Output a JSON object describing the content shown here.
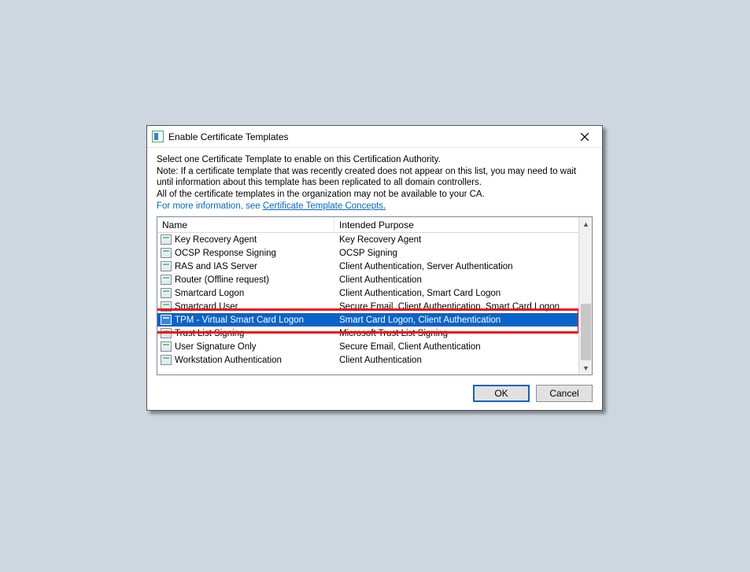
{
  "dialog": {
    "title": "Enable Certificate Templates",
    "instructions": {
      "line1": "Select one Certificate Template to enable on this Certification Authority.",
      "line2": "Note: If a certificate template that was recently created does not appear on this list, you may need to wait until information about this template has been replicated to all domain controllers.",
      "line3": "All of the certificate templates in the organization may not be available to your CA.",
      "moreinfo_prefix": "For more information, see ",
      "moreinfo_link": "Certificate Template Concepts."
    },
    "columns": {
      "name": "Name",
      "purpose": "Intended Purpose"
    },
    "rows": [
      {
        "name": "Key Recovery Agent",
        "purpose": "Key Recovery Agent",
        "selected": false
      },
      {
        "name": "OCSP Response Signing",
        "purpose": "OCSP Signing",
        "selected": false
      },
      {
        "name": "RAS and IAS Server",
        "purpose": "Client Authentication, Server Authentication",
        "selected": false
      },
      {
        "name": "Router (Offline request)",
        "purpose": "Client Authentication",
        "selected": false
      },
      {
        "name": "Smartcard Logon",
        "purpose": "Client Authentication, Smart Card Logon",
        "selected": false
      },
      {
        "name": "Smartcard User",
        "purpose": "Secure Email, Client Authentication, Smart Card Logon",
        "selected": false
      },
      {
        "name": "TPM - Virtual Smart Card Logon",
        "purpose": "Smart Card Logon, Client Authentication",
        "selected": true
      },
      {
        "name": "Trust List Signing",
        "purpose": "Microsoft Trust List Signing",
        "selected": false
      },
      {
        "name": "User Signature Only",
        "purpose": "Secure Email, Client Authentication",
        "selected": false
      },
      {
        "name": "Workstation Authentication",
        "purpose": "Client Authentication",
        "selected": false
      }
    ],
    "buttons": {
      "ok": "OK",
      "cancel": "Cancel"
    },
    "highlighted_index": 6
  }
}
